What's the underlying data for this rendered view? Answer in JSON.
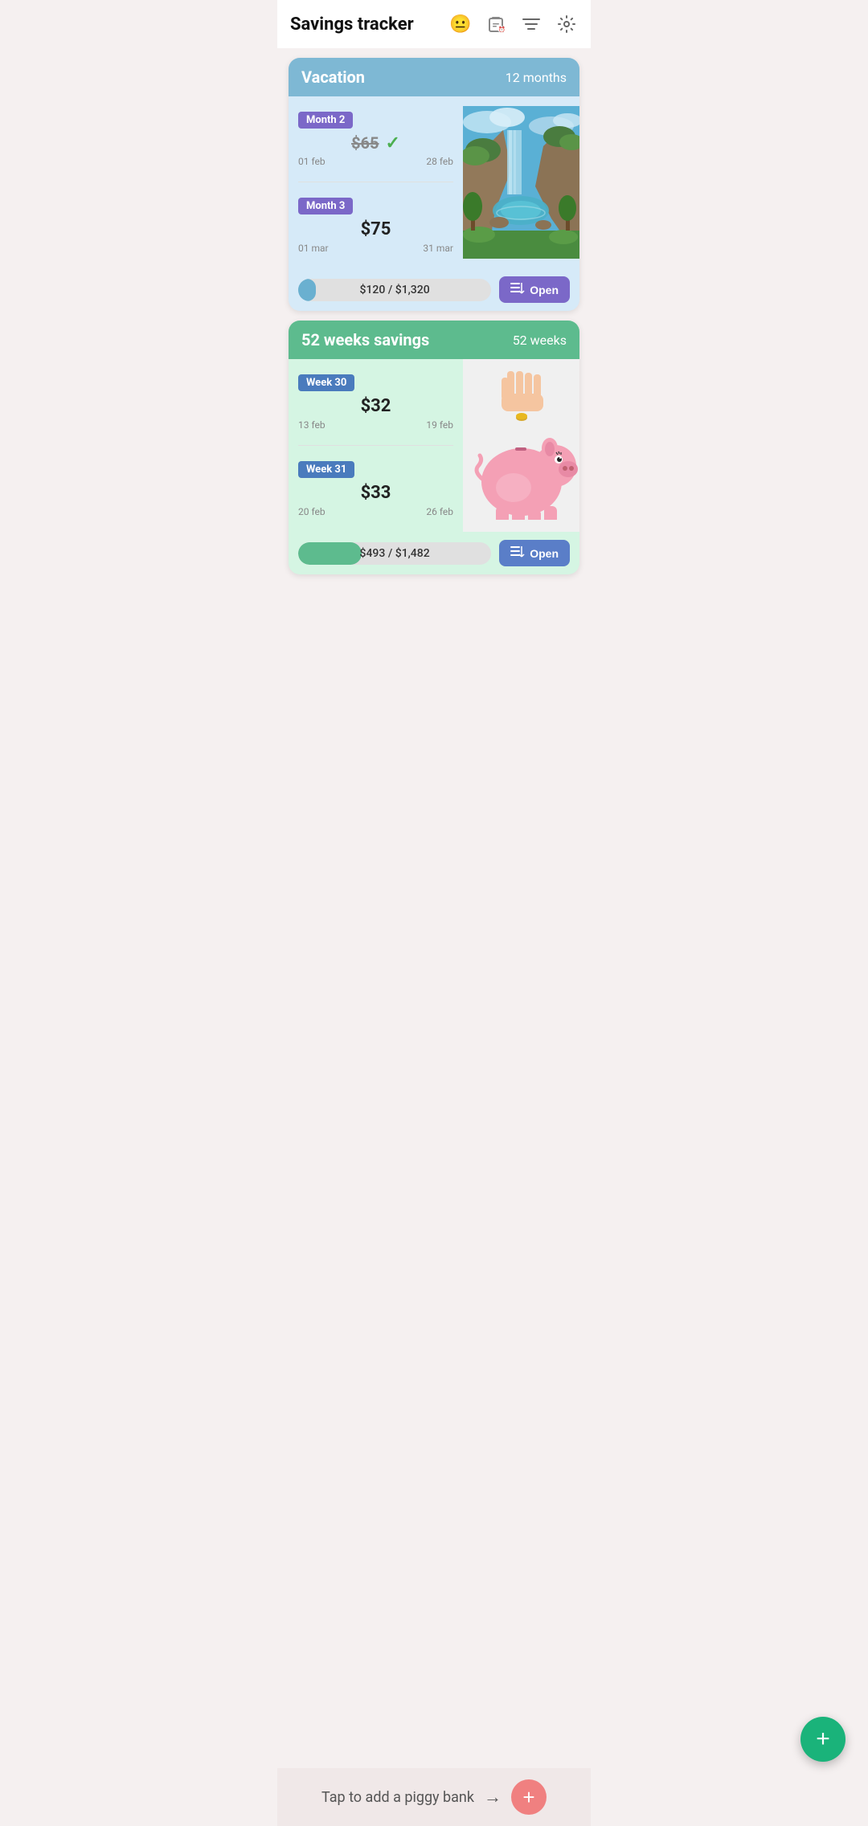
{
  "header": {
    "title": "Savings tracker",
    "icons": {
      "emoji": "😐",
      "clipboard": "📋",
      "filter": "≡",
      "settings": "⚙"
    }
  },
  "vacation_card": {
    "title": "Vacation",
    "duration": "12 months",
    "month2": {
      "label": "Month 2",
      "amount": "$65",
      "strikethrough": true,
      "checked": true,
      "start_date": "01 feb",
      "end_date": "28 feb"
    },
    "month3": {
      "label": "Month 3",
      "amount": "$75",
      "strikethrough": false,
      "checked": false,
      "start_date": "01 mar",
      "end_date": "31 mar"
    },
    "progress_text": "$120 / $1,320",
    "progress_percent": 9,
    "open_label": "Open"
  },
  "weeks_card": {
    "title": "52 weeks savings",
    "duration": "52 weeks",
    "week30": {
      "label": "Week 30",
      "amount": "$32",
      "start_date": "13 feb",
      "end_date": "19 feb"
    },
    "week31": {
      "label": "Week 31",
      "amount": "$33",
      "start_date": "20 feb",
      "end_date": "26 feb"
    },
    "progress_text": "$493 / $1,482",
    "progress_percent": 33,
    "open_label": "Open"
  },
  "fab": {
    "label": "+"
  },
  "bottom_bar": {
    "text": "Tap to add a piggy bank",
    "arrow": "→",
    "plus": "+"
  }
}
